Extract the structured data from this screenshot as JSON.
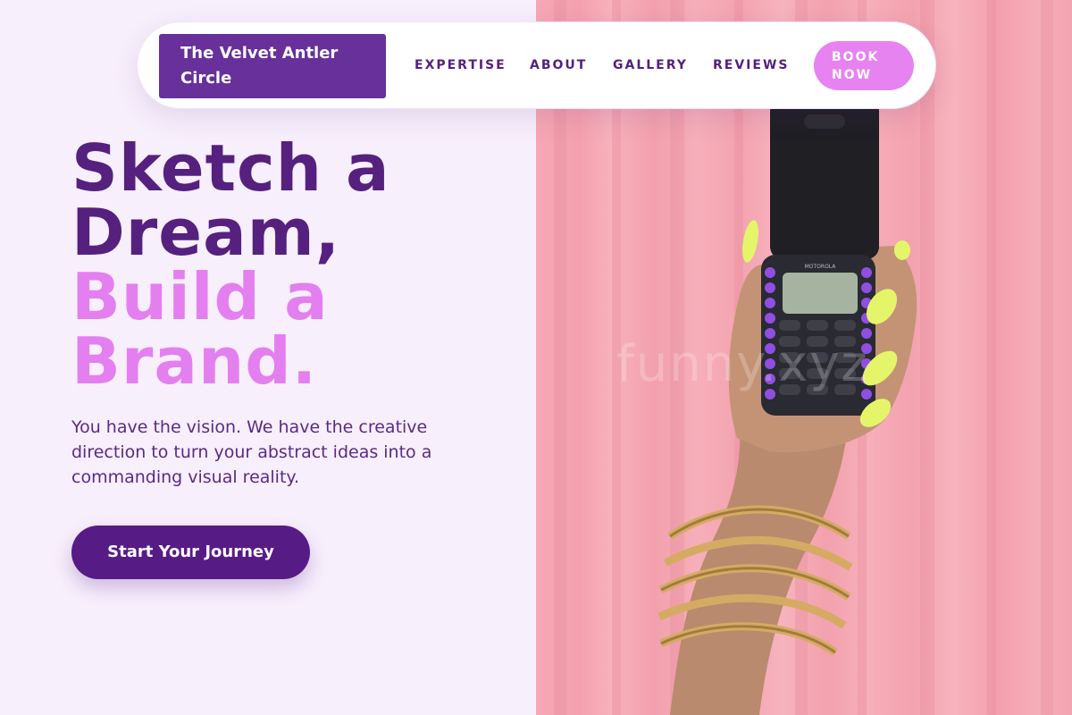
{
  "brand": {
    "name": "The Velvet Antler Circle"
  },
  "nav": {
    "links": [
      "EXPERTISE",
      "ABOUT",
      "GALLERY",
      "REVIEWS"
    ],
    "cta": "BOOK NOW"
  },
  "hero": {
    "headline_line1": "Sketch a",
    "headline_line2": "Dream,",
    "headline_line3": "Build a",
    "headline_line4": "Brand.",
    "description": "You have the vision. We have the creative direction to turn your abstract ideas into a commanding visual reality.",
    "cta": "Start Your Journey"
  },
  "image": {
    "watermark": "funny.xyz",
    "phone_brand": "MOTOROLA",
    "alt_icon": "hand-holding-flip-phone-photo"
  },
  "colors": {
    "brand_purple": "#67309a",
    "deep_purple": "#56207f",
    "accent_pink": "#e683f1",
    "background": "#f7effc",
    "curtain_pink": "#f4a4b1"
  }
}
